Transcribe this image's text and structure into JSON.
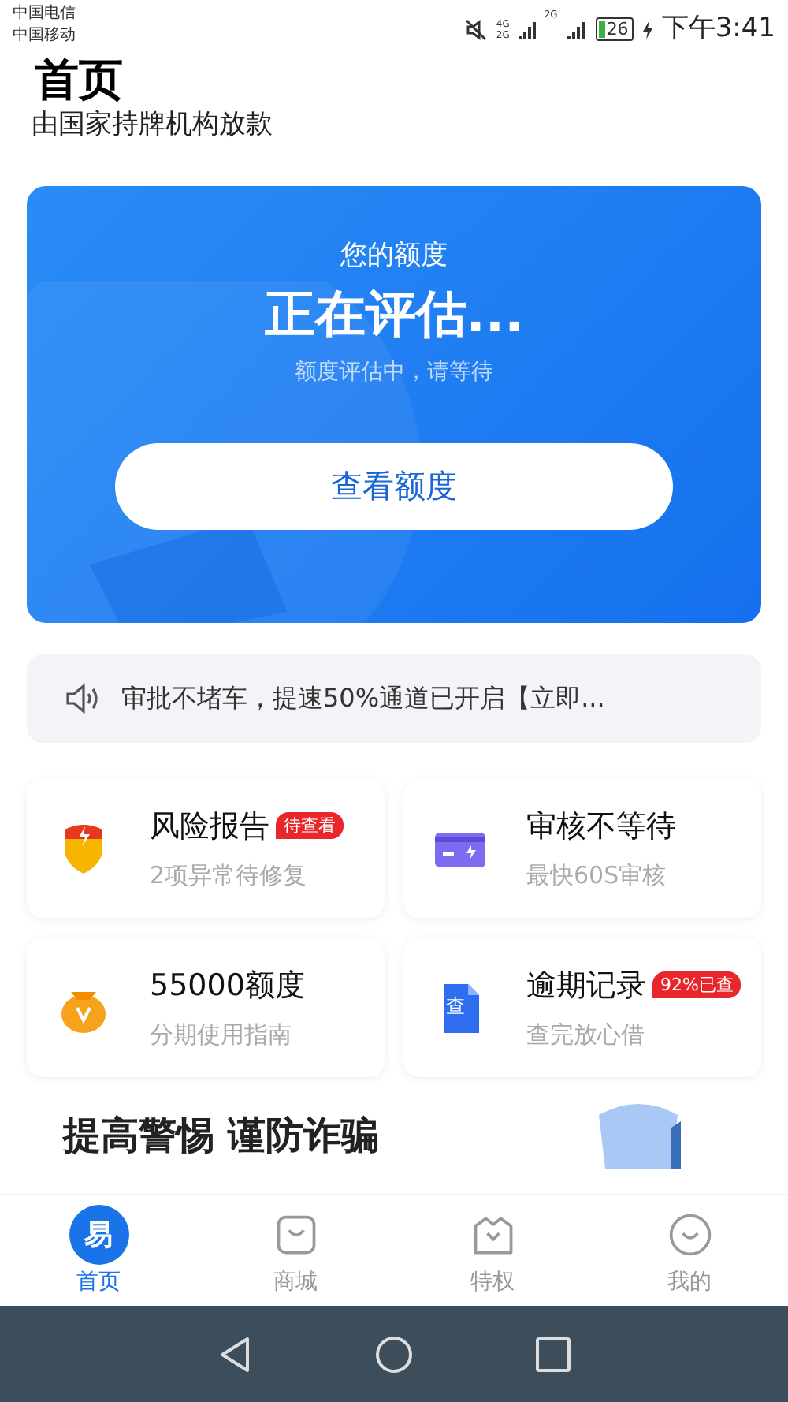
{
  "status_bar": {
    "carriers": [
      "中国电信",
      "中国移动"
    ],
    "network_1": "4G",
    "network_2": "2G",
    "network_3": "2G",
    "battery": "26",
    "time": "下午3:41"
  },
  "header": {
    "title": "首页",
    "subtitle": "由国家持牌机构放款"
  },
  "credit_card": {
    "label": "您的额度",
    "status": "正在评估...",
    "hint": "额度评估中，请等待",
    "button": "查看额度"
  },
  "notice": {
    "text": "审批不堵车，提速50%通道已开启【立即..."
  },
  "services": [
    {
      "kind": "shield",
      "title": "风险报告",
      "badge": "待查看",
      "subtitle": "2项异常待修复"
    },
    {
      "kind": "card",
      "title": "审核不等待",
      "subtitle": "最快60S审核"
    },
    {
      "kind": "bag",
      "title": "55000额度",
      "subtitle": "分期使用指南"
    },
    {
      "kind": "doc",
      "title": "逾期记录",
      "badge": "92%已查",
      "subtitle": "查完放心借",
      "icon_text": "查"
    }
  ],
  "section": {
    "title": "提高警惕 谨防诈骗"
  },
  "tabs": [
    {
      "kind": "home",
      "label": "首页",
      "selected": true,
      "icon_text": "易"
    },
    {
      "kind": "shop",
      "label": "商城",
      "selected": false
    },
    {
      "kind": "crown",
      "label": "特权",
      "selected": false
    },
    {
      "kind": "face",
      "label": "我的",
      "selected": false
    }
  ]
}
